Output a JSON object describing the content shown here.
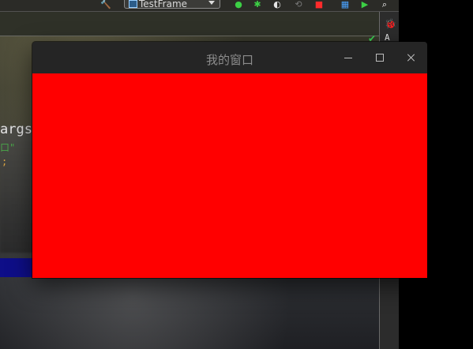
{
  "toolbar": {
    "run_config_label": "TestFrame",
    "icons": [
      "build-icon",
      "debug-icon",
      "run-coverage-icon",
      "profile-icon",
      "stop-icon",
      "layout-icon",
      "run-icon",
      "search-icon"
    ]
  },
  "ide": {
    "code_visible": "args",
    "code_string_fragment": "口\"",
    "code_semicolon": ";",
    "right_panel_ant": "🐞",
    "right_panel_text": "A"
  },
  "window": {
    "title": "我的窗口",
    "content_color": "#ff0000",
    "titlebar_color": "#252525"
  }
}
